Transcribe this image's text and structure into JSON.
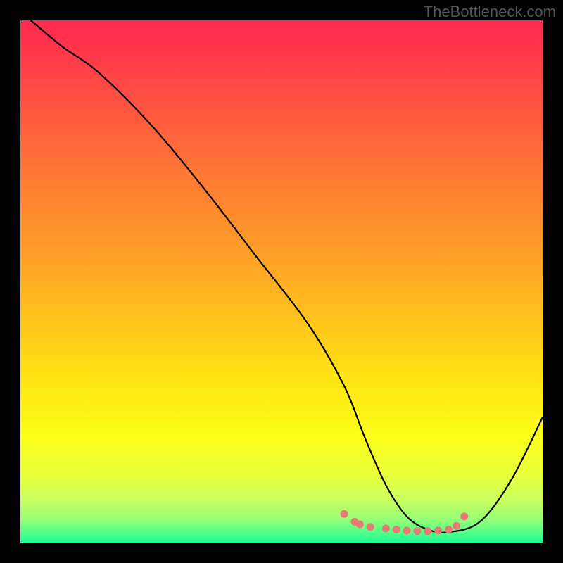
{
  "watermark": "TheBottleneck.com",
  "chart_data": {
    "type": "line",
    "title": "",
    "xlabel": "",
    "ylabel": "",
    "xlim": [
      0,
      100
    ],
    "ylim": [
      0,
      100
    ],
    "annotations": [],
    "series": [
      {
        "name": "bottleneck-curve",
        "x": [
          2,
          8,
          15,
          25,
          35,
          45,
          55,
          62,
          66,
          70,
          74,
          78,
          82,
          88,
          94,
          100
        ],
        "y": [
          100,
          95,
          90,
          80,
          68,
          55,
          42,
          30,
          20,
          11,
          5,
          2.5,
          2,
          4,
          12,
          24
        ],
        "color": "#000000"
      }
    ],
    "markers": {
      "name": "bottom-cluster",
      "color": "#e77a75",
      "points": [
        {
          "x": 62,
          "y": 5.5
        },
        {
          "x": 64,
          "y": 4
        },
        {
          "x": 65,
          "y": 3.5
        },
        {
          "x": 67,
          "y": 3
        },
        {
          "x": 70,
          "y": 2.7
        },
        {
          "x": 72,
          "y": 2.5
        },
        {
          "x": 74,
          "y": 2.3
        },
        {
          "x": 76,
          "y": 2.2
        },
        {
          "x": 78,
          "y": 2.2
        },
        {
          "x": 80,
          "y": 2.3
        },
        {
          "x": 82,
          "y": 2.5
        },
        {
          "x": 83.5,
          "y": 3.2
        },
        {
          "x": 85,
          "y": 5
        }
      ]
    },
    "background_gradient": {
      "orientation": "vertical",
      "stops": [
        {
          "pos": 0,
          "color": "#ff2a4e"
        },
        {
          "pos": 50,
          "color": "#ffb020"
        },
        {
          "pos": 80,
          "color": "#fbff1a"
        },
        {
          "pos": 100,
          "color": "#18ff94"
        }
      ]
    }
  }
}
